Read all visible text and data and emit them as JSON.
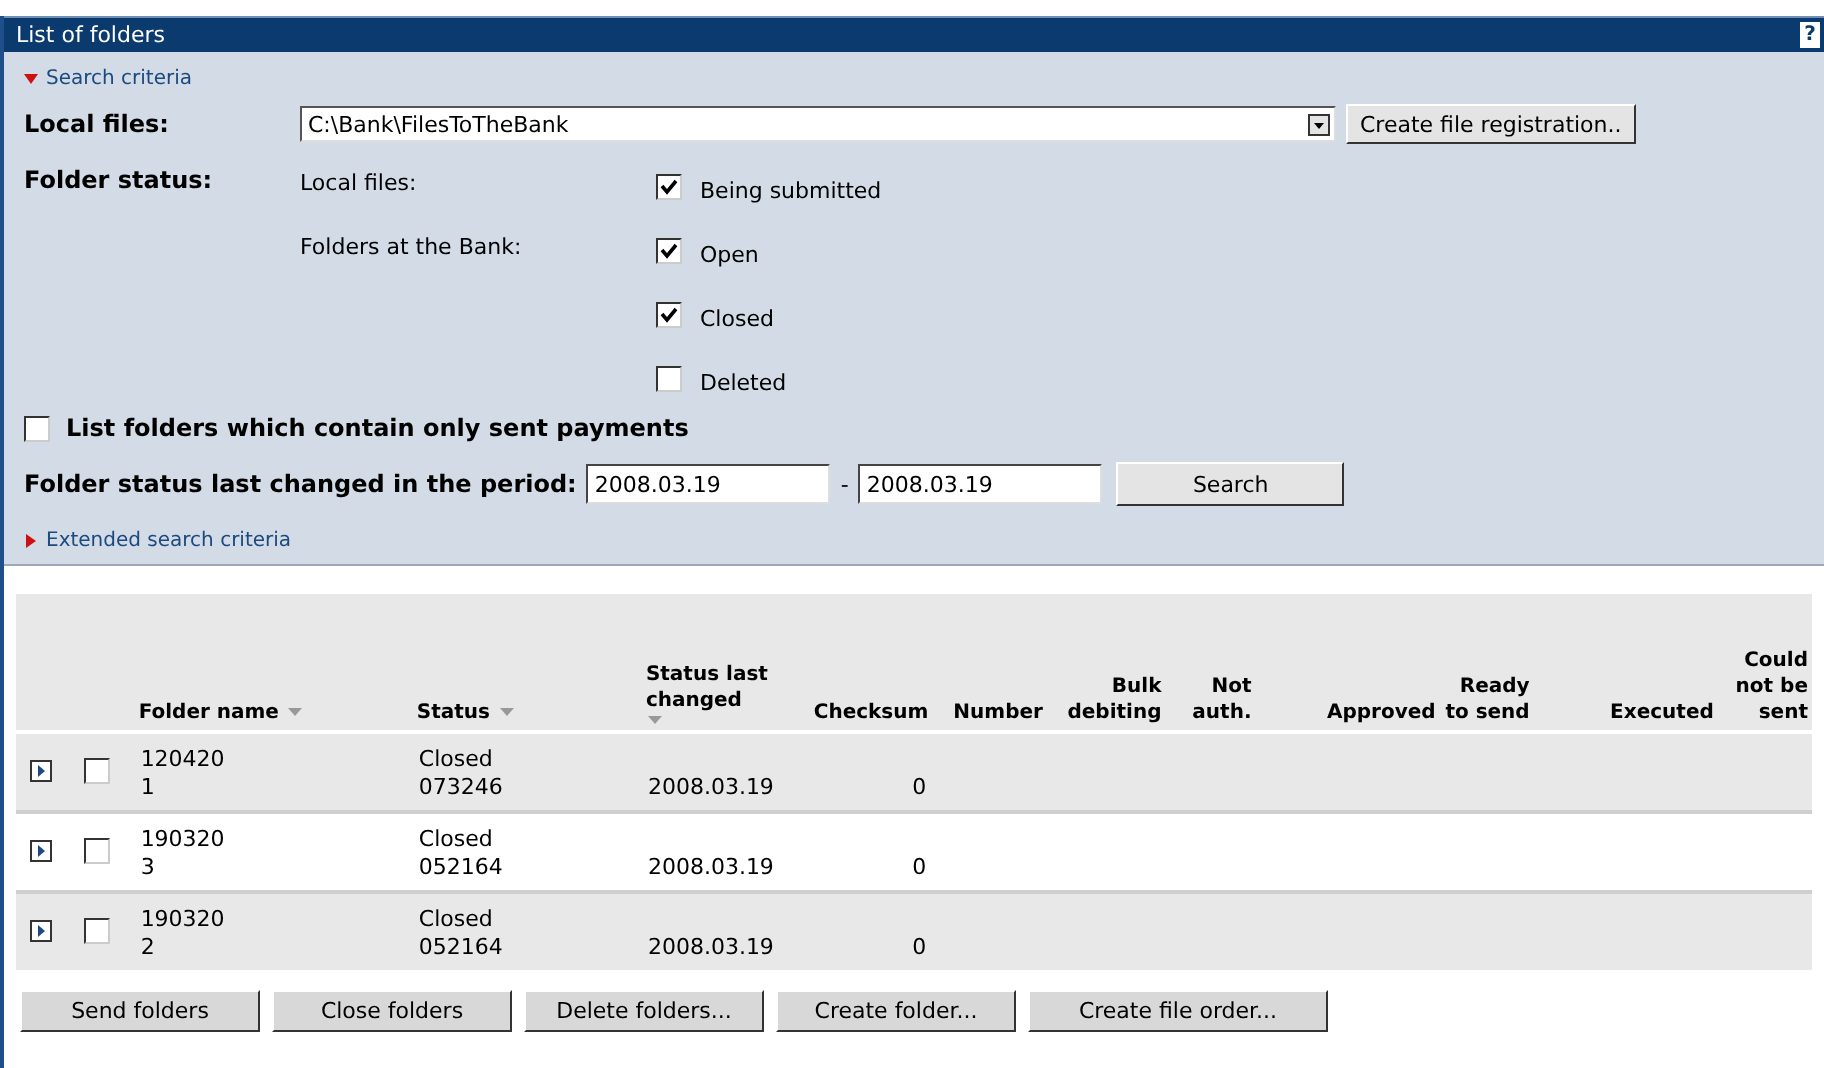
{
  "window": {
    "title": "List of folders",
    "help": "?"
  },
  "search_criteria": {
    "label": "Search criteria",
    "expanded": true
  },
  "local_files": {
    "label": "Local files:",
    "value": "C:\\Bank\\FilesToTheBank",
    "button": "Create file registration.."
  },
  "folder_status": {
    "label": "Folder status:",
    "groups": [
      {
        "label": "Local files:",
        "options": [
          {
            "label": "Being submitted",
            "checked": true
          }
        ]
      },
      {
        "label": "Folders at the Bank:",
        "options": [
          {
            "label": "Open",
            "checked": true
          },
          {
            "label": "Closed",
            "checked": true
          },
          {
            "label": "Deleted",
            "checked": false
          }
        ]
      }
    ]
  },
  "only_sent": {
    "label": "List folders which contain only sent payments",
    "checked": false
  },
  "period": {
    "label": "Folder status last changed in the period:",
    "from": "2008.03.19",
    "separator": "-",
    "to": "2008.03.19",
    "button": "Search"
  },
  "extended_search": {
    "label": "Extended search criteria",
    "expanded": false
  },
  "table": {
    "columns": [
      {
        "label": "Folder name",
        "kind": "sort_inline"
      },
      {
        "label": "Status",
        "kind": "sort_inline"
      },
      {
        "label": "Status last changed",
        "kind": "sort_below"
      },
      {
        "label": "Checksum",
        "kind": "count"
      },
      {
        "label": "Number",
        "kind": "count"
      },
      {
        "label": "Bulk debiting",
        "kind": "count"
      },
      {
        "label": "Not auth.",
        "kind": "count"
      },
      {
        "label": "Approved",
        "kind": "count"
      },
      {
        "label": "Ready to send",
        "kind": "count"
      },
      {
        "label": "Executed",
        "kind": "count"
      },
      {
        "label": "Could not be sent",
        "kind": "count"
      }
    ],
    "rows": [
      {
        "expanded": false,
        "selected": false,
        "folder_name": "120420\n1",
        "status": "Closed\n073246",
        "status_last_changed": "2008.03.19",
        "checksum": "0"
      },
      {
        "expanded": false,
        "selected": false,
        "folder_name": "190320\n3",
        "status": "Closed\n052164",
        "status_last_changed": "2008.03.19",
        "checksum": "0"
      },
      {
        "expanded": false,
        "selected": false,
        "folder_name": "190320\n2",
        "status": "Closed\n052164",
        "status_last_changed": "2008.03.19",
        "checksum": "0"
      }
    ]
  },
  "buttons": [
    "Send folders",
    "Close folders",
    "Delete folders...",
    "Create folder...",
    "Create file order..."
  ]
}
